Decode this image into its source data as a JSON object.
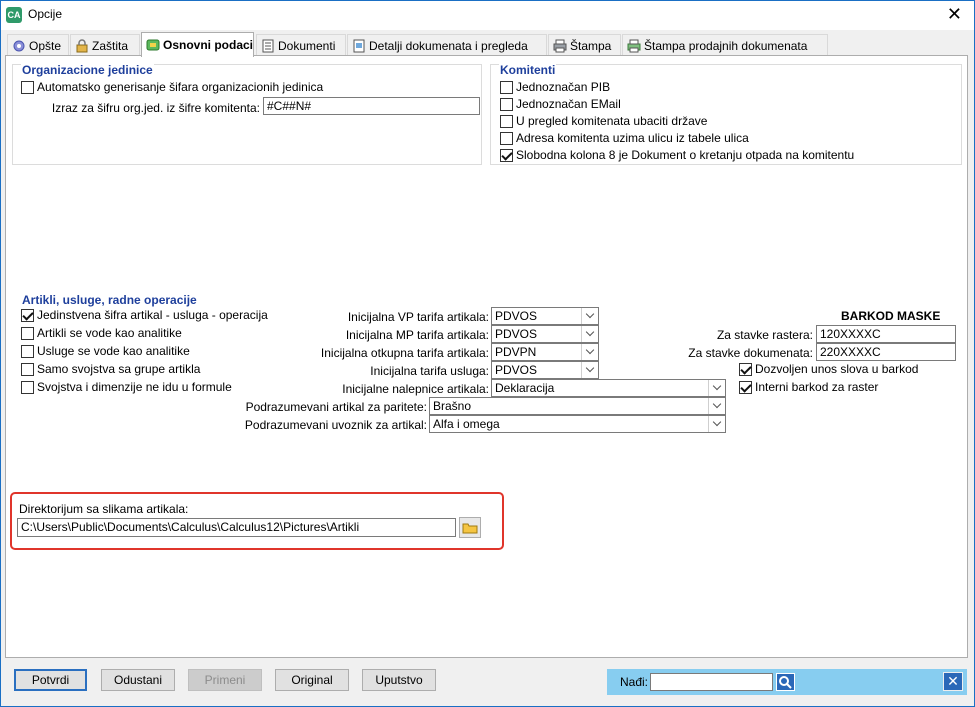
{
  "window": {
    "title": "Opcije"
  },
  "tabs": [
    {
      "label": "Opšte"
    },
    {
      "label": "Zaštita"
    },
    {
      "label": "Osnovni podaci"
    },
    {
      "label": "Dokumenti"
    },
    {
      "label": "Detalji dokumenata i pregleda"
    },
    {
      "label": "Štampa"
    },
    {
      "label": "Štampa prodajnih dokumenata"
    }
  ],
  "org": {
    "title": "Organizacione jedinice",
    "auto_label": "Automatsko generisanje šifara organizacionih jedinica",
    "auto_checked": false,
    "expr_label": "Izraz za šifru org.jed. iz šifre komitenta:",
    "expr_value": "#C##N#"
  },
  "komitenti": {
    "title": "Komitenti",
    "items": [
      {
        "label": "Jednoznačan PIB",
        "checked": false
      },
      {
        "label": "Jednoznačan EMail",
        "checked": false
      },
      {
        "label": "U pregled komitenata ubaciti države",
        "checked": false
      },
      {
        "label": "Adresa komitenta uzima ulicu iz tabele ulica",
        "checked": false
      },
      {
        "label": "Slobodna kolona 8 je Dokument o kretanju otpada na komitentu",
        "checked": true
      }
    ]
  },
  "artikli": {
    "title": "Artikli, usluge, radne operacije",
    "checks": [
      {
        "label": "Jedinstvena šifra artikal - usluga - operacija",
        "checked": true
      },
      {
        "label": "Artikli se vode kao analitike",
        "checked": false
      },
      {
        "label": "Usluge se vode kao analitike",
        "checked": false
      },
      {
        "label": "Samo svojstva sa grupe artikla",
        "checked": false
      },
      {
        "label": "Svojstva i dimenzije ne idu u formule",
        "checked": false
      }
    ],
    "combos": [
      {
        "label": "Inicijalna VP tarifa artikala:",
        "value": "PDVOS"
      },
      {
        "label": "Inicijalna MP tarifa artikala:",
        "value": "PDVOS"
      },
      {
        "label": "Inicijalna otkupna tarifa artikala:",
        "value": "PDVPN"
      },
      {
        "label": "Inicijalna tarifa usluga:",
        "value": "PDVOS"
      },
      {
        "label": "Inicijalne nalepnice artikala:",
        "value": "Deklaracija"
      },
      {
        "label": "Podrazumevani artikal za paritete:",
        "value": "Brašno"
      },
      {
        "label": "Podrazumevani uvoznik za artikal:",
        "value": "Alfa i omega"
      }
    ],
    "barkod": {
      "title": "BARKOD MASKE",
      "raster_label": "Za stavke rastera:",
      "raster_value": "120XXXXC",
      "dok_label": "Za stavke dokumenata:",
      "dok_value": "220XXXXC",
      "slova_label": "Dozvoljen unos slova u barkod",
      "slova_checked": true,
      "interni_label": "Interni barkod za raster",
      "interni_checked": true
    },
    "dir_label": "Direktorijum sa slikama artikala:",
    "dir_value": "C:\\Users\\Public\\Documents\\Calculus\\Calculus12\\Pictures\\Artikli"
  },
  "buttons": {
    "potvrdi": "Potvrdi",
    "odustani": "Odustani",
    "primeni": "Primeni",
    "original": "Original",
    "uputstvo": "Uputstvo"
  },
  "find": {
    "label": "Nađi:",
    "value": ""
  },
  "colors": {
    "group_title": "#1e3f9c",
    "highlight": "#e0352b",
    "findbar": "#87cdf0"
  }
}
